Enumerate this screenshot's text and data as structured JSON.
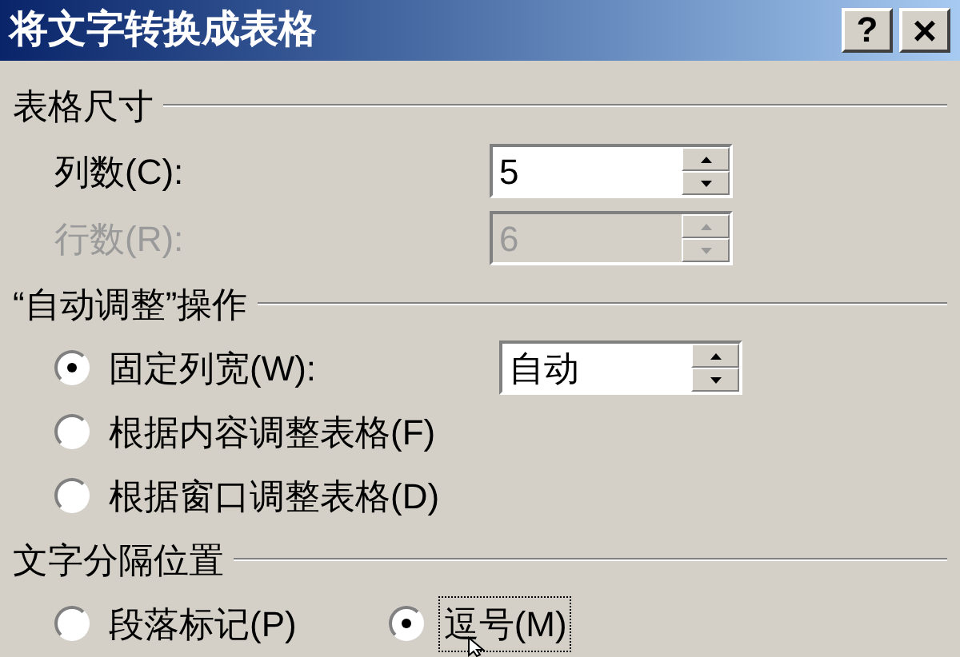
{
  "window": {
    "title": "将文字转换成表格",
    "buttons": [
      {
        "kind": "help",
        "label": "?"
      },
      {
        "kind": "close",
        "label": "×"
      }
    ]
  },
  "sections": [
    {
      "title": "表格尺寸",
      "items": [
        {
          "kind": "spin",
          "label": "列数(C):",
          "value": "5",
          "disabled": false
        },
        {
          "kind": "spin",
          "label": "行数(R):",
          "value": "6",
          "disabled": true
        }
      ]
    },
    {
      "title": "“自动调整”操作",
      "items": [
        {
          "kind": "radio",
          "label": "固定列宽(W):",
          "selected": true,
          "field": {
            "value": "自动"
          }
        },
        {
          "kind": "radio",
          "label": "根据内容调整表格(F)",
          "selected": false
        },
        {
          "kind": "radio",
          "label": "根据窗口调整表格(D)",
          "selected": false
        }
      ]
    },
    {
      "title": "文字分隔位置",
      "inline": true,
      "items": [
        {
          "kind": "radio",
          "label": "段落标记(P)",
          "selected": false,
          "focused": false
        },
        {
          "kind": "radio",
          "label": "逗号(M)",
          "selected": true,
          "focused": true
        }
      ]
    }
  ]
}
